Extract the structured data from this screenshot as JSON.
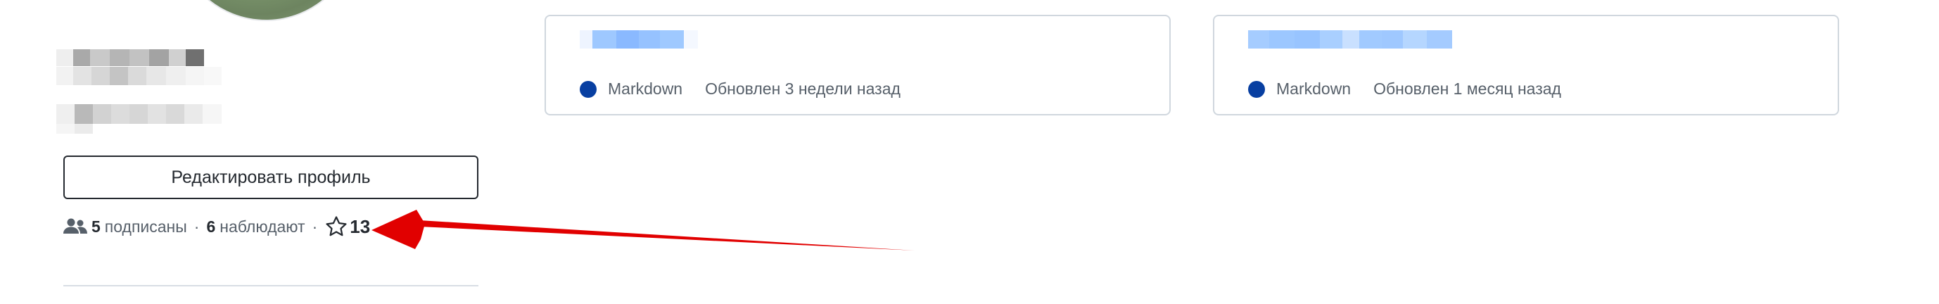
{
  "profile": {
    "edit_button_label": "Редактировать профиль",
    "followers_count": "5",
    "followers_label": "подписаны",
    "separator": "·",
    "following_count": "6",
    "following_label": "наблюдают",
    "stars_count": "13"
  },
  "repos": [
    {
      "language": "Markdown",
      "language_color": "#083fa1",
      "updated": "Обновлен 3 недели назад"
    },
    {
      "language": "Markdown",
      "language_color": "#083fa1",
      "updated": "Обновлен 1 месяц назад"
    }
  ],
  "icons": {
    "people": "people-icon",
    "star": "star-icon",
    "language": "language-color-dot"
  },
  "colors": {
    "annotation_arrow": "#e10000",
    "link_placeholder": "#8ab9ff"
  }
}
